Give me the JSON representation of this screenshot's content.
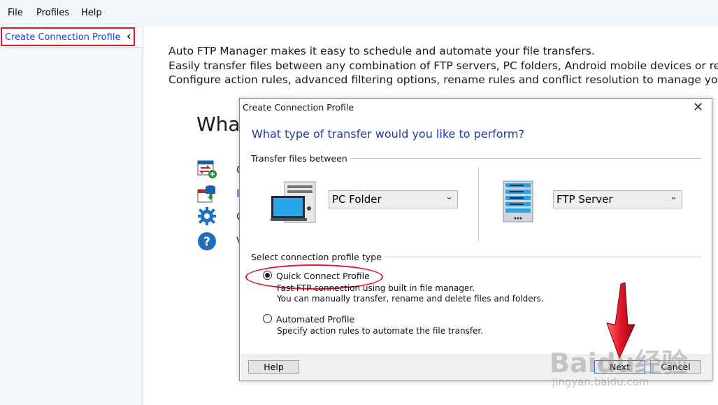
{
  "menu": {
    "items": [
      "File",
      "Profiles",
      "Help"
    ]
  },
  "sidebar": {
    "items": [
      {
        "label": "Create Connection Profile"
      }
    ]
  },
  "intro": {
    "line1": "Auto FTP Manager makes it easy to schedule and automate your file transfers.",
    "line2": "Easily transfer files between any combination of FTP servers, PC folders, Android mobile devices or rem",
    "line3": "Configure action rules, advanced filtering options, rename rules and conflict resolution to manage your"
  },
  "main": {
    "heading_partial": "What",
    "side_texts": [
      "C",
      "I",
      "C",
      "V"
    ]
  },
  "dialog": {
    "title": "Create Connection Profile",
    "heading": "What type of transfer would you like to perform?",
    "transfer_group_label": "Transfer files between",
    "source_select": {
      "value": "PC Folder"
    },
    "dest_select": {
      "value": "FTP Server"
    },
    "profile_type_group_label": "Select connection profile type",
    "options": [
      {
        "label": "Quick Connect Profile",
        "checked": true,
        "desc1": "Fast FTP connection using built in file manager.",
        "desc2": "You can manually transfer, rename and delete files and folders."
      },
      {
        "label": "Automated Profile",
        "checked": false,
        "desc1": "Specify action rules to automate the file transfer."
      }
    ],
    "buttons": {
      "help": "Help",
      "next": "Next",
      "cancel": "Cancel"
    }
  },
  "watermark": {
    "text": "Baidu经验",
    "sub": "jingyan.baidu.com"
  },
  "colors": {
    "annotation_red": "#e2142a",
    "link_blue": "#1c3fd1",
    "heading_blue": "#1f3aa8"
  }
}
